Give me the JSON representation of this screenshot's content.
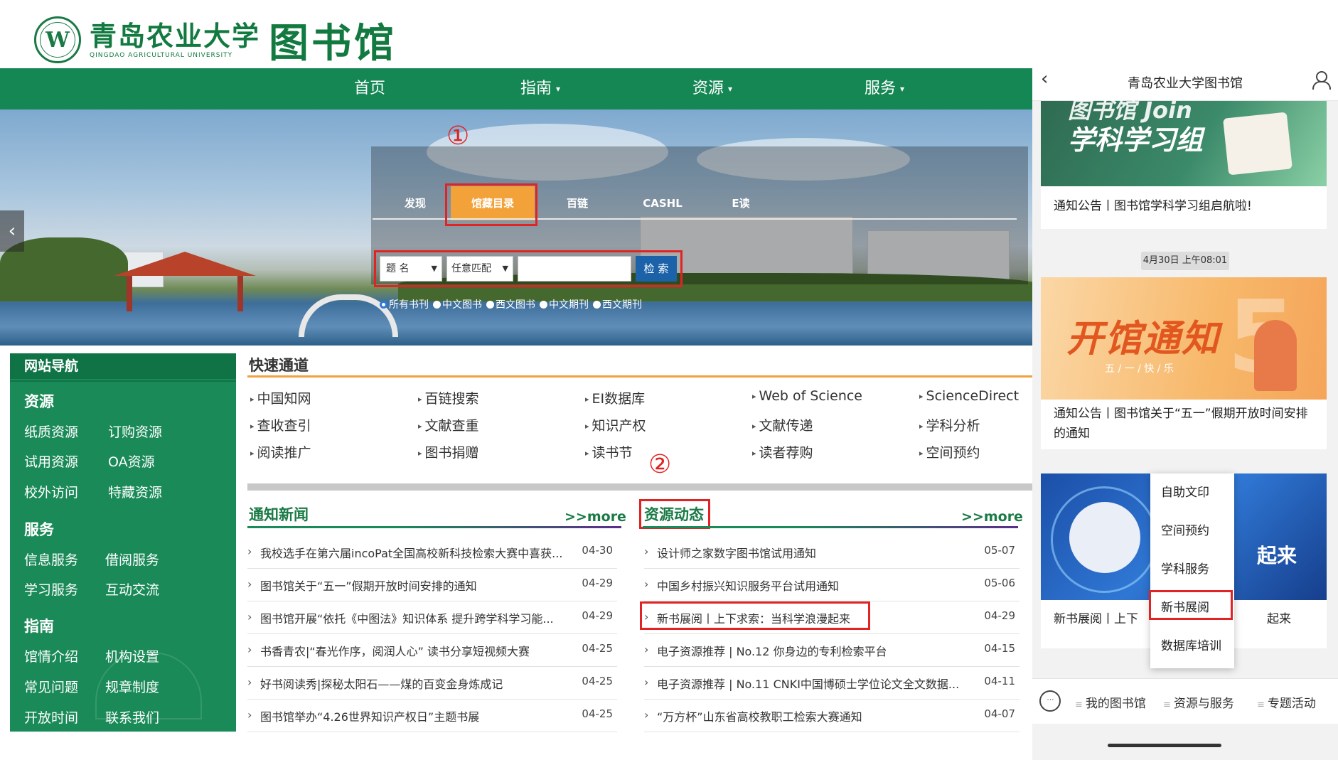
{
  "site": {
    "logo": {
      "seal_letter": "W",
      "name_cn": "青岛农业大学",
      "name_en": "QINGDAO AGRICULTURAL UNIVERSITY",
      "library": "图书馆"
    },
    "nav": [
      "首页",
      "指南",
      "资源",
      "服务"
    ],
    "search": {
      "tabs": [
        "发现",
        "馆藏目录",
        "百链",
        "CASHL",
        "E读"
      ],
      "active_tab": "馆藏目录",
      "field": "题 名",
      "match": "任意匹配",
      "button": "检 索",
      "scope": [
        "所有书刊",
        "中文图书",
        "西文图书",
        "中文期刊",
        "西文期刊"
      ]
    },
    "annotations": [
      "①",
      "②"
    ],
    "sidebar": {
      "title": "网站导航",
      "sections": [
        {
          "name": "资源",
          "links": [
            "纸质资源",
            "订购资源",
            "试用资源",
            "OA资源",
            "校外访问",
            "特藏资源"
          ]
        },
        {
          "name": "服务",
          "links": [
            "信息服务",
            "借阅服务",
            "学习服务",
            "互动交流"
          ]
        },
        {
          "name": "指南",
          "links": [
            "馆情介绍",
            "机构设置",
            "常见问题",
            "规章制度",
            "开放时间",
            "联系我们"
          ]
        }
      ]
    },
    "quick_access": {
      "title": "快速通道",
      "items": [
        "中国知网",
        "百链搜索",
        "EI数据库",
        "Web of Science",
        "ScienceDirect",
        "查收查引",
        "文献查重",
        "知识产权",
        "文献传递",
        "学科分析",
        "阅读推广",
        "图书捐赠",
        "读书节",
        "读者荐购",
        "空间预约"
      ]
    },
    "notices": {
      "title": "通知新闻",
      "more": ">>more",
      "rows": [
        {
          "title": "我校选手在第六届incoPat全国高校新科技检索大赛中喜获...",
          "date": "04-30"
        },
        {
          "title": "图书馆关于“五一”假期开放时间安排的通知",
          "date": "04-29"
        },
        {
          "title": "图书馆开展“依托《中图法》知识体系 提升跨学科学习能...",
          "date": "04-29"
        },
        {
          "title": "书香青农|“春光作序，阅润人心” 读书分享短视频大赛",
          "date": "04-25"
        },
        {
          "title": "好书阅读秀|探秘太阳石——煤的百变金身炼成记",
          "date": "04-25"
        },
        {
          "title": "图书馆举办“4.26世界知识产权日”主题书展",
          "date": "04-25"
        }
      ]
    },
    "resources": {
      "title": "资源动态",
      "more": ">>more",
      "rows": [
        {
          "title": "设计师之家数字图书馆试用通知",
          "date": "05-07"
        },
        {
          "title": "中国乡村振兴知识服务平台试用通知",
          "date": "05-06"
        },
        {
          "title": "新书展阅丨上下求索：当科学浪漫起来",
          "date": "04-29"
        },
        {
          "title": "电子资源推荐 | No.12 你身边的专利检索平台",
          "date": "04-15"
        },
        {
          "title": "电子资源推荐 | No.11 CNKI中国博硕士学位论文全文数据...",
          "date": "04-11"
        },
        {
          "title": "“万方杯”山东省高校教职工检索大赛通知",
          "date": "04-07"
        }
      ]
    }
  },
  "phone": {
    "title": "青岛农业大学图书馆",
    "card1": {
      "banner_top": "图书馆 Join",
      "banner": "学科学习组",
      "caption": "通知公告丨图书馆学科学习组启航啦!"
    },
    "timestamp": "4月30日 上午08:01",
    "card2": {
      "banner": "开馆通知",
      "banner_sub": "五 / 一 / 快 / 乐",
      "banner_num": "5",
      "caption": "通知公告丨图书馆关于“五一”假期开放时间安排的通知"
    },
    "card3": {
      "banner_right": "起来",
      "caption_left": "新书展阅丨上下",
      "caption_right": "起来"
    },
    "menu": [
      "自助文印",
      "空间预约",
      "学科服务",
      "新书展阅",
      "数据库培训"
    ],
    "menu_highlight": "新书展阅",
    "bottom_tabs": [
      "我的图书馆",
      "资源与服务",
      "专题活动"
    ]
  },
  "colors": {
    "green": "#148754",
    "dark_green": "#0f7346",
    "orange": "#f3a23a",
    "highlight_red": "#e02424",
    "search_blue": "#1b62a8"
  }
}
